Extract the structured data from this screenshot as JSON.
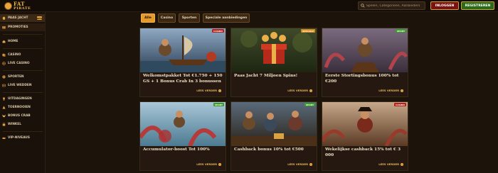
{
  "header": {
    "logo_line1": "FAT",
    "logo_line2": "PIRATE",
    "search_placeholder": "Spelen, Categorieën, Aanbieders",
    "login_label": "INLOGGEN",
    "register_label": "REGISTREREN"
  },
  "sidebar": {
    "items": [
      {
        "label": "PAAS JACHT",
        "icon": "egg-icon",
        "badge": "NEW"
      },
      {
        "label": "PROMOTIES",
        "icon": "gift-icon"
      },
      {
        "label": "HOME",
        "icon": "home-icon"
      },
      {
        "label": "CASINO",
        "icon": "cards-icon"
      },
      {
        "label": "LIVE CASINO",
        "icon": "live-icon"
      },
      {
        "label": "SPORTEN",
        "icon": "ball-icon"
      },
      {
        "label": "LIVE WEDDEN",
        "icon": "live-bet-icon"
      },
      {
        "label": "UITDAGINGEN",
        "icon": "trophy-icon"
      },
      {
        "label": "TOERNOOIEN",
        "icon": "tournament-icon"
      },
      {
        "label": "BONUS CRAB",
        "icon": "crab-icon"
      },
      {
        "label": "WINKEL",
        "icon": "shop-icon"
      },
      {
        "label": "VIP-NIVEAUS",
        "icon": "crown-icon"
      }
    ]
  },
  "filters": {
    "tabs": [
      "Alle",
      "Casino",
      "Sporten",
      "Speciale aanbiedingen"
    ]
  },
  "promotions": [
    {
      "title": "Welkomstpakket Tot €1.750 + 150 GS + 1 Bonus Crab In 3 bonussen",
      "tag": "CASINO",
      "more": "LEES VERDER"
    },
    {
      "title": "Paas Jacht 7 Miljoen Spins!",
      "tag": "SPECIALE",
      "more": "LEES VERDER"
    },
    {
      "title": "Eerste Stortingsbonus 100% tot €200",
      "tag": "SPORT",
      "more": "LEES VERDER"
    },
    {
      "title": "Accumulator-boost Tot 100%",
      "tag": "SPORT",
      "more": "LEES VERDER"
    },
    {
      "title": "Cashback bonus 10% tot €500",
      "tag": "SPORT",
      "more": "LEES VERDER"
    },
    {
      "title": "Wekelijkse cashback 15% tot € 3 000",
      "tag": "CASINO",
      "more": "LEES VERDER"
    }
  ],
  "colors": {
    "accent": "#e59a2e",
    "login": "#7a1212",
    "register": "#2a6a1a",
    "background": "#1c130b"
  }
}
